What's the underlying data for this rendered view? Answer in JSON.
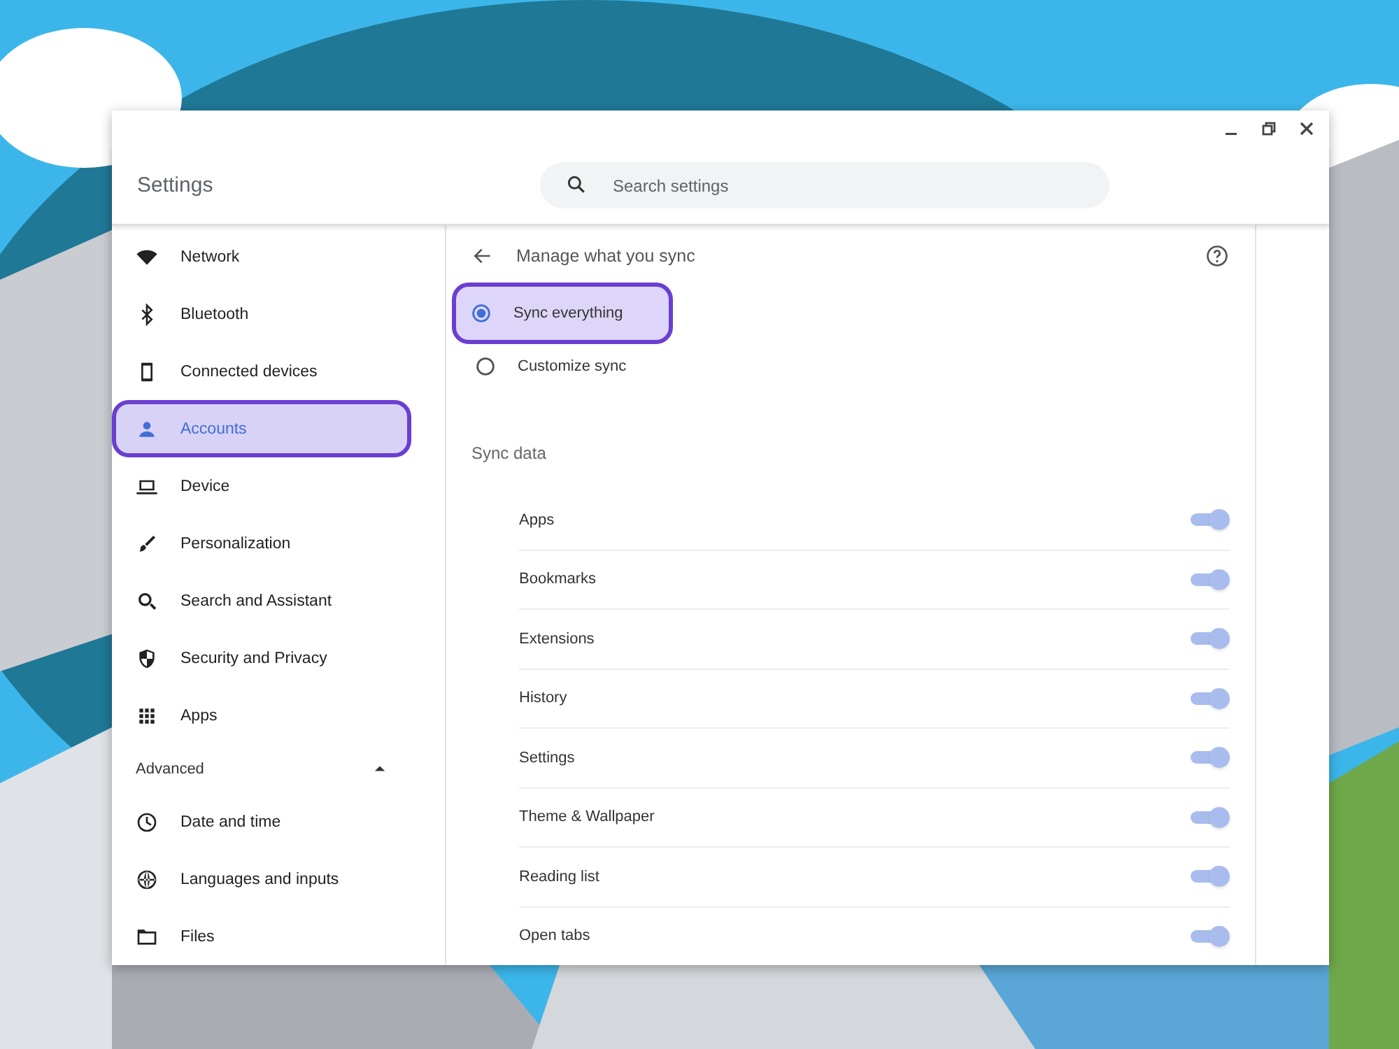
{
  "window": {
    "title": "Settings"
  },
  "search": {
    "placeholder": "Search settings"
  },
  "sidebar": {
    "items": [
      {
        "label": "Network",
        "selected": false
      },
      {
        "label": "Bluetooth",
        "selected": false
      },
      {
        "label": "Connected devices",
        "selected": false
      },
      {
        "label": "Accounts",
        "selected": true
      },
      {
        "label": "Device",
        "selected": false
      },
      {
        "label": "Personalization",
        "selected": false
      },
      {
        "label": "Search and Assistant",
        "selected": false
      },
      {
        "label": "Security and Privacy",
        "selected": false
      },
      {
        "label": "Apps",
        "selected": false
      }
    ],
    "advanced": {
      "label": "Advanced",
      "expanded": true,
      "items": [
        {
          "label": "Date and time",
          "selected": false
        },
        {
          "label": "Languages and inputs",
          "selected": false
        },
        {
          "label": "Files",
          "selected": false
        }
      ]
    }
  },
  "page": {
    "title": "Manage what you sync",
    "options": [
      {
        "label": "Sync everything",
        "selected": true
      },
      {
        "label": "Customize sync",
        "selected": false
      }
    ],
    "section": "Sync data",
    "toggles": [
      {
        "label": "Apps",
        "on": true,
        "disabled": true
      },
      {
        "label": "Bookmarks",
        "on": true,
        "disabled": true
      },
      {
        "label": "Extensions",
        "on": true,
        "disabled": true
      },
      {
        "label": "History",
        "on": true,
        "disabled": true
      },
      {
        "label": "Settings",
        "on": true,
        "disabled": true
      },
      {
        "label": "Theme & Wallpaper",
        "on": true,
        "disabled": true
      },
      {
        "label": "Reading list",
        "on": true,
        "disabled": true
      },
      {
        "label": "Open tabs",
        "on": true,
        "disabled": true
      }
    ]
  }
}
